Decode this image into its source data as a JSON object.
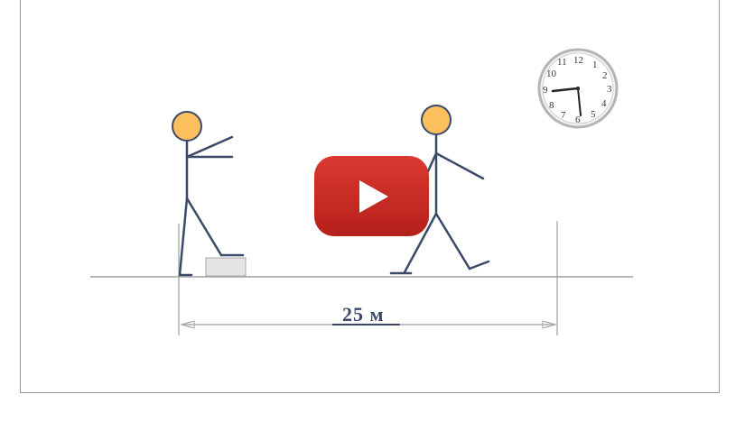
{
  "video": {
    "play_icon": "play-icon",
    "brand_color": "#d32f2f"
  },
  "scene": {
    "distance_label": "25 м",
    "clock": {
      "numbers": [
        "12",
        "1",
        "2",
        "3",
        "4",
        "5",
        "6",
        "7",
        "8",
        "9",
        "10",
        "11"
      ]
    },
    "colors": {
      "figure": "#3c4a6a",
      "head": "#fbbf5e",
      "ground": "#9a9a9a"
    }
  }
}
